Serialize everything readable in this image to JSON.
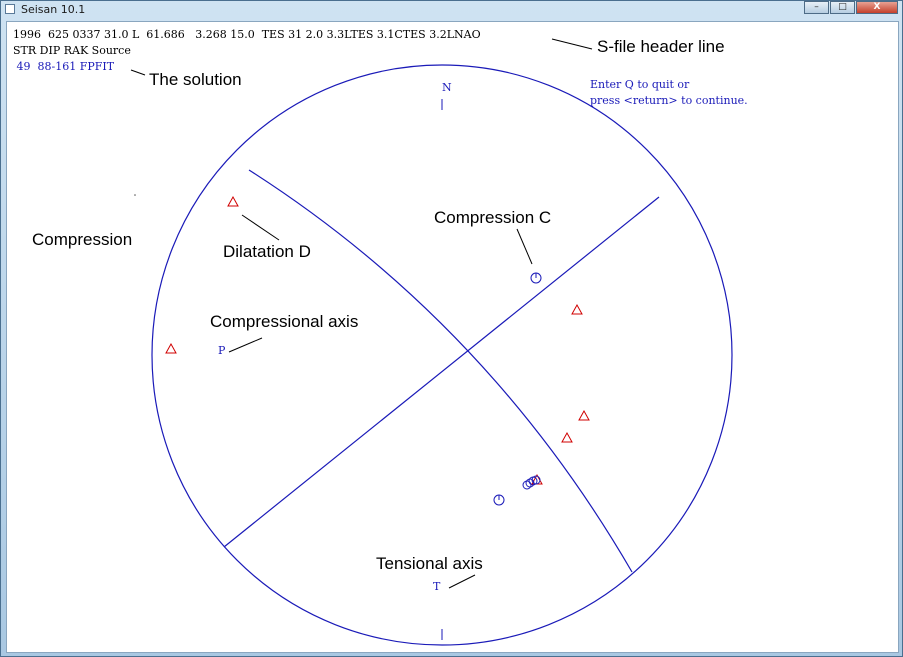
{
  "window": {
    "title": "Seisan 10.1",
    "buttons": {
      "minimize": "–",
      "maximize": "□",
      "close": "X"
    }
  },
  "header": {
    "line1": "1996  625 0337 31.0 L  61.686   3.268 15.0  TES 31 2.0 3.3LTES 3.1CTES 3.2LNAO",
    "line2": "STR DIP RAK Source",
    "solution": " 49  88-161 FPFIT"
  },
  "prompt": {
    "line1": "Enter Q to quit or",
    "line2": "press <return> to continue."
  },
  "plot": {
    "north_label": "N",
    "p_axis_label": "P",
    "t_axis_label": "T"
  },
  "annotations": {
    "header_line": "S-file header line",
    "solution": "The solution",
    "compression": "Compression",
    "dilatation": "Dilatation D",
    "compression_c": "Compression C",
    "compressional_axis": "Compressional axis",
    "tensional_axis": "Tensional axis"
  },
  "colors": {
    "plot_blue": "#1a1ab8",
    "dilatation_red": "#d00000"
  }
}
